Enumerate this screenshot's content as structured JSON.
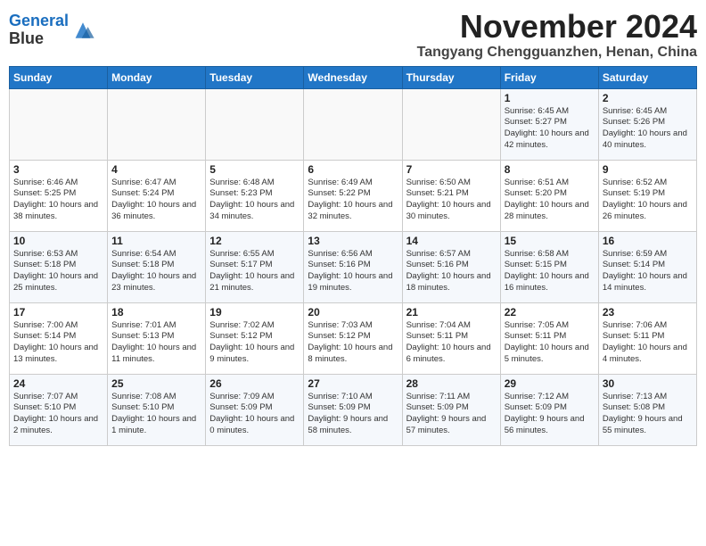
{
  "header": {
    "logo_line1": "General",
    "logo_line2": "Blue",
    "month": "November 2024",
    "location": "Tangyang Chengguanzhen, Henan, China"
  },
  "weekdays": [
    "Sunday",
    "Monday",
    "Tuesday",
    "Wednesday",
    "Thursday",
    "Friday",
    "Saturday"
  ],
  "weeks": [
    [
      {
        "day": "",
        "info": ""
      },
      {
        "day": "",
        "info": ""
      },
      {
        "day": "",
        "info": ""
      },
      {
        "day": "",
        "info": ""
      },
      {
        "day": "",
        "info": ""
      },
      {
        "day": "1",
        "info": "Sunrise: 6:45 AM\nSunset: 5:27 PM\nDaylight: 10 hours and 42 minutes."
      },
      {
        "day": "2",
        "info": "Sunrise: 6:45 AM\nSunset: 5:26 PM\nDaylight: 10 hours and 40 minutes."
      }
    ],
    [
      {
        "day": "3",
        "info": "Sunrise: 6:46 AM\nSunset: 5:25 PM\nDaylight: 10 hours and 38 minutes."
      },
      {
        "day": "4",
        "info": "Sunrise: 6:47 AM\nSunset: 5:24 PM\nDaylight: 10 hours and 36 minutes."
      },
      {
        "day": "5",
        "info": "Sunrise: 6:48 AM\nSunset: 5:23 PM\nDaylight: 10 hours and 34 minutes."
      },
      {
        "day": "6",
        "info": "Sunrise: 6:49 AM\nSunset: 5:22 PM\nDaylight: 10 hours and 32 minutes."
      },
      {
        "day": "7",
        "info": "Sunrise: 6:50 AM\nSunset: 5:21 PM\nDaylight: 10 hours and 30 minutes."
      },
      {
        "day": "8",
        "info": "Sunrise: 6:51 AM\nSunset: 5:20 PM\nDaylight: 10 hours and 28 minutes."
      },
      {
        "day": "9",
        "info": "Sunrise: 6:52 AM\nSunset: 5:19 PM\nDaylight: 10 hours and 26 minutes."
      }
    ],
    [
      {
        "day": "10",
        "info": "Sunrise: 6:53 AM\nSunset: 5:18 PM\nDaylight: 10 hours and 25 minutes."
      },
      {
        "day": "11",
        "info": "Sunrise: 6:54 AM\nSunset: 5:18 PM\nDaylight: 10 hours and 23 minutes."
      },
      {
        "day": "12",
        "info": "Sunrise: 6:55 AM\nSunset: 5:17 PM\nDaylight: 10 hours and 21 minutes."
      },
      {
        "day": "13",
        "info": "Sunrise: 6:56 AM\nSunset: 5:16 PM\nDaylight: 10 hours and 19 minutes."
      },
      {
        "day": "14",
        "info": "Sunrise: 6:57 AM\nSunset: 5:16 PM\nDaylight: 10 hours and 18 minutes."
      },
      {
        "day": "15",
        "info": "Sunrise: 6:58 AM\nSunset: 5:15 PM\nDaylight: 10 hours and 16 minutes."
      },
      {
        "day": "16",
        "info": "Sunrise: 6:59 AM\nSunset: 5:14 PM\nDaylight: 10 hours and 14 minutes."
      }
    ],
    [
      {
        "day": "17",
        "info": "Sunrise: 7:00 AM\nSunset: 5:14 PM\nDaylight: 10 hours and 13 minutes."
      },
      {
        "day": "18",
        "info": "Sunrise: 7:01 AM\nSunset: 5:13 PM\nDaylight: 10 hours and 11 minutes."
      },
      {
        "day": "19",
        "info": "Sunrise: 7:02 AM\nSunset: 5:12 PM\nDaylight: 10 hours and 9 minutes."
      },
      {
        "day": "20",
        "info": "Sunrise: 7:03 AM\nSunset: 5:12 PM\nDaylight: 10 hours and 8 minutes."
      },
      {
        "day": "21",
        "info": "Sunrise: 7:04 AM\nSunset: 5:11 PM\nDaylight: 10 hours and 6 minutes."
      },
      {
        "day": "22",
        "info": "Sunrise: 7:05 AM\nSunset: 5:11 PM\nDaylight: 10 hours and 5 minutes."
      },
      {
        "day": "23",
        "info": "Sunrise: 7:06 AM\nSunset: 5:11 PM\nDaylight: 10 hours and 4 minutes."
      }
    ],
    [
      {
        "day": "24",
        "info": "Sunrise: 7:07 AM\nSunset: 5:10 PM\nDaylight: 10 hours and 2 minutes."
      },
      {
        "day": "25",
        "info": "Sunrise: 7:08 AM\nSunset: 5:10 PM\nDaylight: 10 hours and 1 minute."
      },
      {
        "day": "26",
        "info": "Sunrise: 7:09 AM\nSunset: 5:09 PM\nDaylight: 10 hours and 0 minutes."
      },
      {
        "day": "27",
        "info": "Sunrise: 7:10 AM\nSunset: 5:09 PM\nDaylight: 9 hours and 58 minutes."
      },
      {
        "day": "28",
        "info": "Sunrise: 7:11 AM\nSunset: 5:09 PM\nDaylight: 9 hours and 57 minutes."
      },
      {
        "day": "29",
        "info": "Sunrise: 7:12 AM\nSunset: 5:09 PM\nDaylight: 9 hours and 56 minutes."
      },
      {
        "day": "30",
        "info": "Sunrise: 7:13 AM\nSunset: 5:08 PM\nDaylight: 9 hours and 55 minutes."
      }
    ]
  ]
}
